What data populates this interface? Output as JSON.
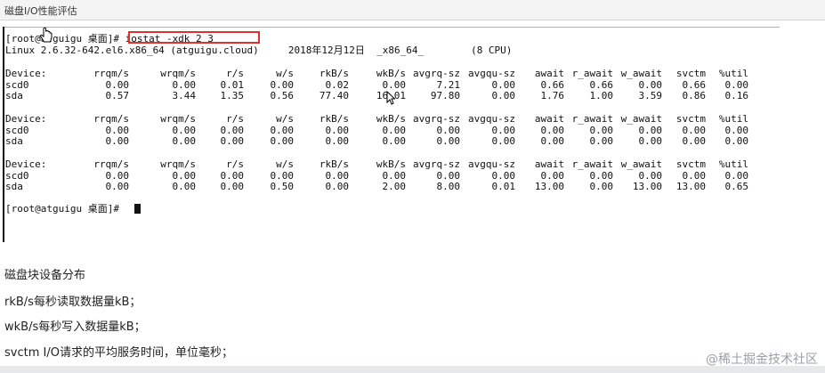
{
  "window": {
    "title": "磁盘I/O性能评估"
  },
  "terminal": {
    "prompt_line": "[root@atguigu 桌面]# iostat -xdk 2 3",
    "system_line": "Linux 2.6.32-642.el6.x86_64 (atguigu.cloud)     2018年12月12日  _x86_64_        (8 CPU)",
    "final_prompt": "[root@atguigu 桌面]# ",
    "command": "iostat -xdk 2 3",
    "columns": [
      "Device:",
      "rrqm/s",
      "wrqm/s",
      "r/s",
      "w/s",
      "rkB/s",
      "wkB/s",
      "avgrq-sz",
      "avgqu-sz",
      "await",
      "r_await",
      "w_await",
      "svctm",
      "%util"
    ],
    "blocks": [
      {
        "rows": [
          {
            "device": "scd0",
            "values": [
              "0.00",
              "0.00",
              "0.01",
              "0.00",
              "0.02",
              "0.00",
              "7.21",
              "0.00",
              "0.66",
              "0.66",
              "0.00",
              "0.66",
              "0.00"
            ]
          },
          {
            "device": "sda",
            "values": [
              "0.57",
              "3.44",
              "1.35",
              "0.56",
              "77.40",
              "16.01",
              "97.80",
              "0.00",
              "1.76",
              "1.00",
              "3.59",
              "0.86",
              "0.16"
            ]
          }
        ]
      },
      {
        "rows": [
          {
            "device": "scd0",
            "values": [
              "0.00",
              "0.00",
              "0.00",
              "0.00",
              "0.00",
              "0.00",
              "0.00",
              "0.00",
              "0.00",
              "0.00",
              "0.00",
              "0.00",
              "0.00"
            ]
          },
          {
            "device": "sda",
            "values": [
              "0.00",
              "0.00",
              "0.00",
              "0.00",
              "0.00",
              "0.00",
              "0.00",
              "0.00",
              "0.00",
              "0.00",
              "0.00",
              "0.00",
              "0.00"
            ]
          }
        ]
      },
      {
        "rows": [
          {
            "device": "scd0",
            "values": [
              "0.00",
              "0.00",
              "0.00",
              "0.00",
              "0.00",
              "0.00",
              "0.00",
              "0.00",
              "0.00",
              "0.00",
              "0.00",
              "0.00",
              "0.00"
            ]
          },
          {
            "device": "sda",
            "values": [
              "0.00",
              "0.00",
              "0.00",
              "0.50",
              "0.00",
              "2.00",
              "8.00",
              "0.01",
              "13.00",
              "0.00",
              "13.00",
              "13.00",
              "0.65"
            ]
          }
        ]
      }
    ],
    "highlight_color": "#e03030"
  },
  "notes": {
    "heading": "磁盘块设备分布",
    "line1": "rkB/s每秒读取数据量kB；",
    "line2": "wkB/s每秒写入数据量kB；",
    "line3": "svctm I/O请求的平均服务时间，单位毫秒；"
  },
  "watermark": "@稀土掘金技术社区",
  "icons": [
    "hand-pointer-icon",
    "arrow-pointer-icon",
    "text-cursor-icon"
  ]
}
